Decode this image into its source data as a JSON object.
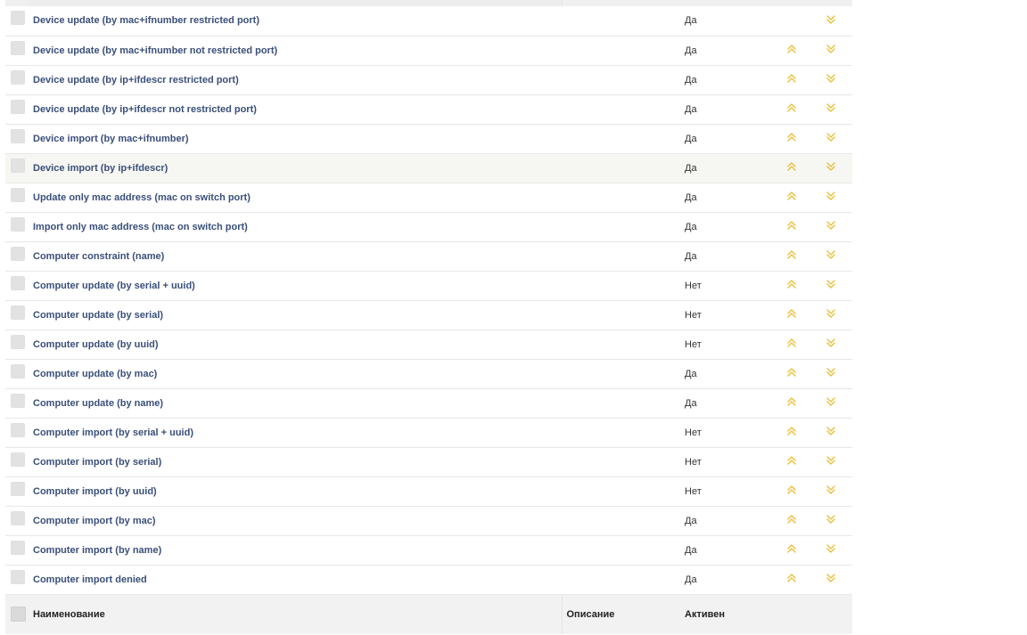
{
  "columns": {
    "name": "Наименование",
    "description": "Описание",
    "active": "Активен"
  },
  "colors": {
    "link": "#3a4f7a",
    "chevron": "#e8c03c"
  },
  "icons": {
    "up": "double-chevron-up-icon",
    "down": "double-chevron-down-icon"
  },
  "rows": [
    {
      "name": "Device update (by mac+ifnumber restricted port)",
      "active": "Да",
      "up": false,
      "down": true
    },
    {
      "name": "Device update (by mac+ifnumber not restricted port)",
      "active": "Да",
      "up": true,
      "down": true
    },
    {
      "name": "Device update (by ip+ifdescr restricted port)",
      "active": "Да",
      "up": true,
      "down": true
    },
    {
      "name": "Device update (by ip+ifdescr not restricted port)",
      "active": "Да",
      "up": true,
      "down": true
    },
    {
      "name": "Device import (by mac+ifnumber)",
      "active": "Да",
      "up": true,
      "down": true
    },
    {
      "name": "Device import (by ip+ifdescr)",
      "active": "Да",
      "up": true,
      "down": true,
      "highlighted": true
    },
    {
      "name": "Update only mac address (mac on switch port)",
      "active": "Да",
      "up": true,
      "down": true
    },
    {
      "name": "Import only mac address (mac on switch port)",
      "active": "Да",
      "up": true,
      "down": true
    },
    {
      "name": "Computer constraint (name)",
      "active": "Да",
      "up": true,
      "down": true
    },
    {
      "name": "Computer update (by serial + uuid)",
      "active": "Нет",
      "up": true,
      "down": true
    },
    {
      "name": "Computer update (by serial)",
      "active": "Нет",
      "up": true,
      "down": true
    },
    {
      "name": "Computer update (by uuid)",
      "active": "Нет",
      "up": true,
      "down": true
    },
    {
      "name": "Computer update (by mac)",
      "active": "Да",
      "up": true,
      "down": true
    },
    {
      "name": "Computer update (by name)",
      "active": "Да",
      "up": true,
      "down": true
    },
    {
      "name": "Computer import (by serial + uuid)",
      "active": "Нет",
      "up": true,
      "down": true
    },
    {
      "name": "Computer import (by serial)",
      "active": "Нет",
      "up": true,
      "down": true
    },
    {
      "name": "Computer import (by uuid)",
      "active": "Нет",
      "up": true,
      "down": true
    },
    {
      "name": "Computer import (by mac)",
      "active": "Да",
      "up": true,
      "down": true
    },
    {
      "name": "Computer import (by name)",
      "active": "Да",
      "up": true,
      "down": true
    },
    {
      "name": "Computer import denied",
      "active": "Да",
      "up": true,
      "down": true
    }
  ]
}
